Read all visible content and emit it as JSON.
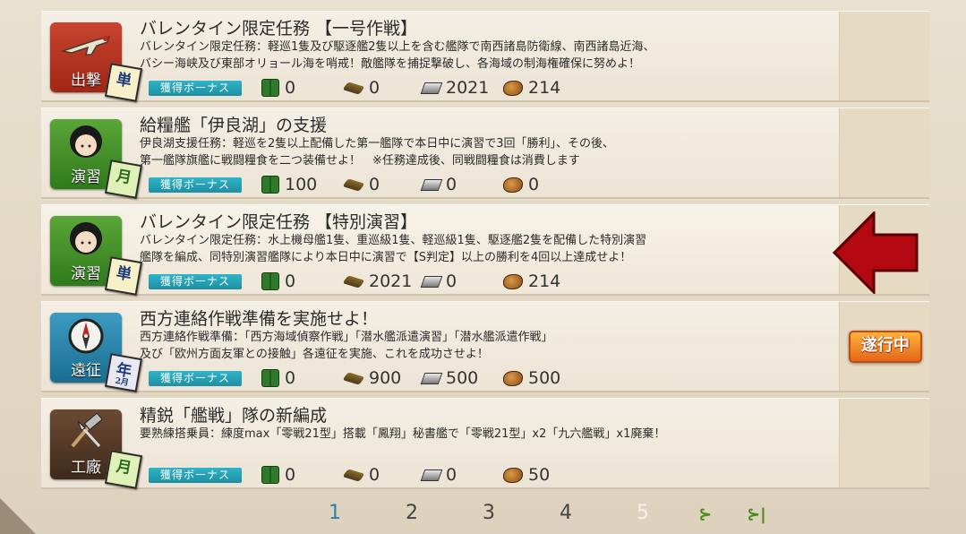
{
  "bonus_label": "獲得ボーナス",
  "quests": [
    {
      "category_label": "出撃",
      "category_icon": "plane-icon",
      "type_badge": "単",
      "type_badge_sub": "",
      "title": "バレンタイン限定任務 【一号作戦】",
      "desc1": "バレンタイン限定任務：軽巡1隻及び駆逐艦2隻以上を含む艦隊で南西諸島防衛線、南西諸島近海、",
      "desc2": "バシー海峡及び東部オリョール海を哨戒！敵艦隊を捕捉撃破し、各海域の制海権確保に努めよ！",
      "fuel": "0",
      "ammo": "0",
      "steel": "2021",
      "baux": "214",
      "status": ""
    },
    {
      "category_label": "演習",
      "category_icon": "girl-face-icon",
      "type_badge": "月",
      "type_badge_sub": "",
      "title": "給糧艦「伊良湖」の支援",
      "desc1": "伊良湖支援任務：軽巡を2隻以上配備した第一艦隊で本日中に演習で3回「勝利」、その後、",
      "desc2": "第一艦隊旗艦に戦闘糧食を二つ装備せよ！　※任務達成後、同戦闘糧食は消費します",
      "fuel": "100",
      "ammo": "0",
      "steel": "0",
      "baux": "0",
      "status": ""
    },
    {
      "category_label": "演習",
      "category_icon": "girl-face-icon",
      "type_badge": "単",
      "type_badge_sub": "",
      "title": "バレンタイン限定任務 【特別演習】",
      "desc1": "バレンタイン限定任務：水上機母艦1隻、重巡級1隻、軽巡級1隻、駆逐艦2隻を配備した特別演習",
      "desc2": "艦隊を編成、同特別演習艦隊により本日中に演習で【S判定】以上の勝利を4回以上達成せよ！",
      "fuel": "0",
      "ammo": "2021",
      "steel": "0",
      "baux": "214",
      "status": ""
    },
    {
      "category_label": "遠征",
      "category_icon": "compass-icon",
      "type_badge": "年",
      "type_badge_sub": "2月",
      "title": "西方連絡作戦準備を実施せよ！",
      "desc1": "西方連絡作戦準備：「西方海域偵察作戦」「潜水艦派遣演習」「潜水艦派遣作戦」",
      "desc2": "及び「欧州方面友軍との接触」各遠征を実施、これを成功させよ！",
      "fuel": "0",
      "ammo": "900",
      "steel": "500",
      "baux": "500",
      "status": "遂行中"
    },
    {
      "category_label": "工廠",
      "category_icon": "hammer-icon",
      "type_badge": "月",
      "type_badge_sub": "",
      "title": "精鋭「艦戦」隊の新編成",
      "desc1": "要熟練搭乗員：練度max「零戦21型」搭載「鳳翔」秘書艦で「零戦21型」x2「九六艦戦」x1廃棄！",
      "desc2": "",
      "fuel": "0",
      "ammo": "0",
      "steel": "0",
      "baux": "50",
      "status": ""
    }
  ],
  "pager": {
    "pages": [
      "1",
      "2",
      "3",
      "4",
      "5"
    ],
    "current": "1",
    "next_symbol": "⊱",
    "last_symbol": "⊱|"
  },
  "colors": {
    "arrow": "#b3080f",
    "bonus": "#1f8ea3",
    "stamp": "#e5661a"
  }
}
